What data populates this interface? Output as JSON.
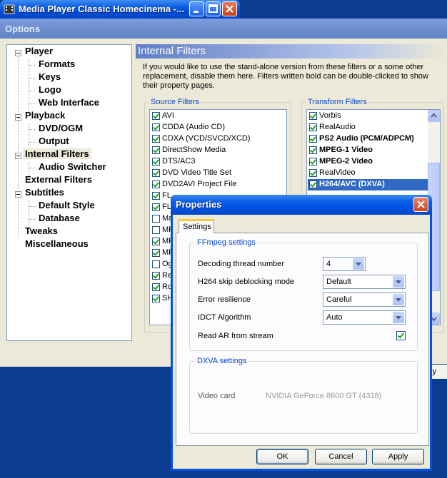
{
  "app": {
    "title": "Media Player Classic Homecinema -..."
  },
  "options": {
    "title": "Options",
    "tree": [
      {
        "label": "Player",
        "level": 0,
        "expandable": true
      },
      {
        "label": "Formats",
        "level": 1
      },
      {
        "label": "Keys",
        "level": 1
      },
      {
        "label": "Logo",
        "level": 1
      },
      {
        "label": "Web Interface",
        "level": 1
      },
      {
        "label": "Playback",
        "level": 0,
        "expandable": true
      },
      {
        "label": "DVD/OGM",
        "level": 1
      },
      {
        "label": "Output",
        "level": 1
      },
      {
        "label": "Internal Filters",
        "level": 0,
        "expandable": true,
        "selected": true
      },
      {
        "label": "Audio Switcher",
        "level": 1
      },
      {
        "label": "External Filters",
        "level": 0
      },
      {
        "label": "Subtitles",
        "level": 0,
        "expandable": true
      },
      {
        "label": "Default Style",
        "level": 1
      },
      {
        "label": "Database",
        "level": 1
      },
      {
        "label": "Tweaks",
        "level": 0
      },
      {
        "label": "Miscellaneous",
        "level": 0
      }
    ],
    "panel_title": "Internal Filters",
    "description": "If you would like to use the stand-alone version from these filters or a some other replacement, disable them here. Filters written bold can be double-clicked to show their property pages.",
    "source_filters_label": "Source Filters",
    "source_filters": [
      {
        "label": "AVI",
        "checked": true
      },
      {
        "label": "CDDA (Audio CD)",
        "checked": true
      },
      {
        "label": "CDXA (VCD/SVCD/XCD)",
        "checked": true
      },
      {
        "label": "DirectShow Media",
        "checked": true
      },
      {
        "label": "DTS/AC3",
        "checked": true
      },
      {
        "label": "DVD Video Title Set",
        "checked": true
      },
      {
        "label": "DVD2AVI Project File",
        "checked": true
      },
      {
        "label": "FL",
        "checked": true
      },
      {
        "label": "FL",
        "checked": true
      },
      {
        "label": "Ma",
        "checked": false
      },
      {
        "label": "MP",
        "checked": false
      },
      {
        "label": "MP",
        "checked": true
      },
      {
        "label": "MP",
        "checked": true
      },
      {
        "label": "Og",
        "checked": false
      },
      {
        "label": "Re",
        "checked": true
      },
      {
        "label": "Ro",
        "checked": true
      },
      {
        "label": "SH",
        "checked": true
      }
    ],
    "transform_filters_label": "Transform Filters",
    "transform_filters": [
      {
        "label": "Vorbis",
        "checked": true,
        "bold": false
      },
      {
        "label": "RealAudio",
        "checked": true,
        "bold": false
      },
      {
        "label": "PS2 Audio (PCM/ADPCM)",
        "checked": true,
        "bold": true
      },
      {
        "label": "MPEG-1 Video",
        "checked": true,
        "bold": true
      },
      {
        "label": "MPEG-2 Video",
        "checked": true,
        "bold": true
      },
      {
        "label": "RealVideo",
        "checked": true,
        "bold": false
      },
      {
        "label": "H264/AVC (DXVA)",
        "checked": true,
        "bold": true,
        "highlighted": true
      }
    ],
    "apply_partial": "ply"
  },
  "properties": {
    "title": "Properties",
    "tab": "Settings",
    "ffmpeg_group": "FFmpeg settings",
    "decoding_threads_label": "Decoding thread number",
    "decoding_threads_value": "4",
    "h264_skip_label": "H264 skip deblocking mode",
    "h264_skip_value": "Default",
    "error_resilience_label": "Error resilience",
    "error_resilience_value": "Careful",
    "idct_label": "IDCT Algorithm",
    "idct_value": "Auto",
    "read_ar_label": "Read AR from stream",
    "read_ar_checked": true,
    "dxva_group": "DXVA settings",
    "video_card_label": "Video card",
    "video_card_value": "NVIDIA GeForce 8600 GT  (4318)",
    "ok": "OK",
    "cancel": "Cancel",
    "apply": "Apply"
  },
  "colors": {
    "xp_blue": "#0055e5",
    "options_face": "#ece9d8",
    "group_label": "#0046d5",
    "selection": "#316ac5"
  }
}
